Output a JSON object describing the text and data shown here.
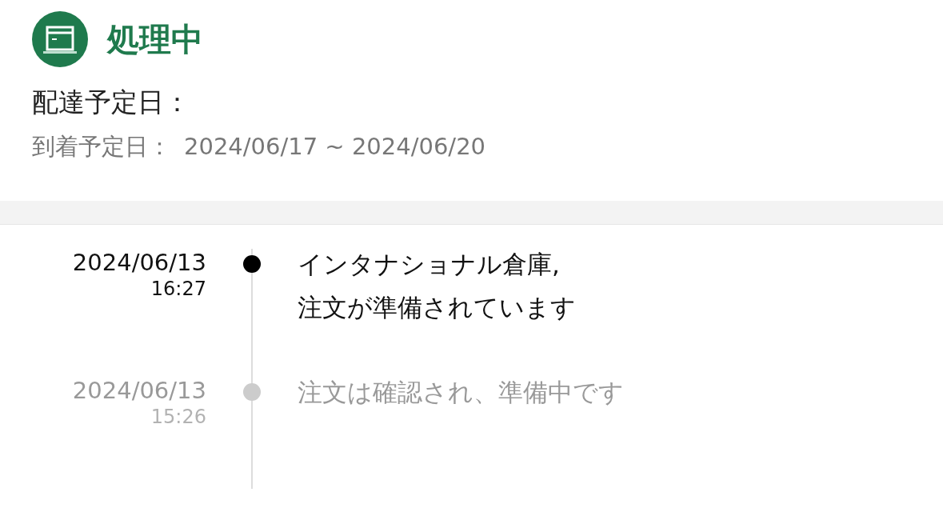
{
  "status": {
    "title": "処理中"
  },
  "delivery": {
    "heading": "配達予定日：",
    "label": "到着予定日：",
    "range": "2024/06/17 ~ 2024/06/20"
  },
  "timeline": [
    {
      "date": "2024/06/13",
      "time": "16:27",
      "lines": [
        "インタナショナル倉庫,",
        "注文が準備されています"
      ],
      "current": true
    },
    {
      "date": "2024/06/13",
      "time": "15:26",
      "lines": [
        "注文は確認され、準備中です"
      ],
      "current": false
    }
  ]
}
